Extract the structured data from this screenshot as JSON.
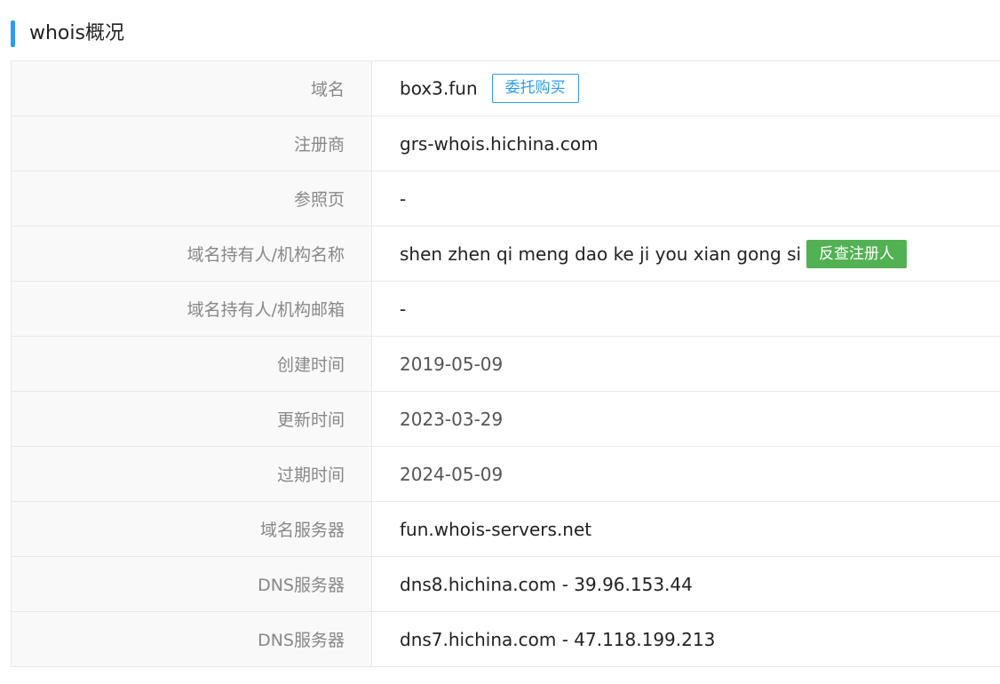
{
  "section": {
    "title": "whois概况",
    "accent_color": "#2d9cf0"
  },
  "rows": [
    {
      "label": "域名",
      "value": "box3.fun",
      "button": "委托购买"
    },
    {
      "label": "注册商",
      "value": "grs-whois.hichina.com"
    },
    {
      "label": "参照页",
      "value": "-"
    },
    {
      "label": "域名持有人/机构名称",
      "value": "shen zhen qi meng dao ke ji you xian gong si",
      "button": "反查注册人"
    },
    {
      "label": "域名持有人/机构邮箱",
      "value": "-"
    },
    {
      "label": "创建时间",
      "value": "2019-05-09"
    },
    {
      "label": "更新时间",
      "value": "2023-03-29"
    },
    {
      "label": "过期时间",
      "value": "2024-05-09"
    },
    {
      "label": "域名服务器",
      "value": "fun.whois-servers.net"
    },
    {
      "label": "DNS服务器",
      "value": "dns8.hichina.com - 39.96.153.44"
    },
    {
      "label": "DNS服务器",
      "value": "dns7.hichina.com - 47.118.199.213"
    }
  ],
  "colors": {
    "outline_button": "#2d9cf0",
    "green_button": "#52b153",
    "label_bg": "#f9f9f9"
  }
}
